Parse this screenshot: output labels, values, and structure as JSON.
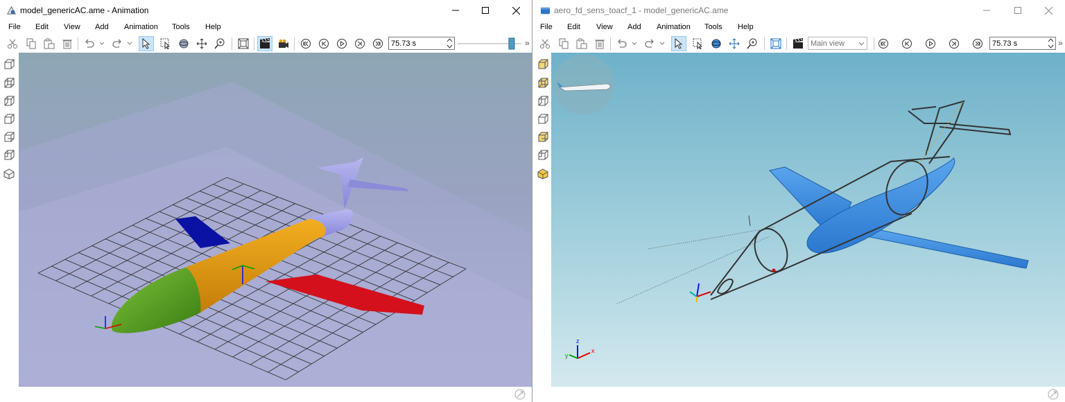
{
  "left_window": {
    "title": "model_genericAC.ame - Animation",
    "menu": [
      "File",
      "Edit",
      "View",
      "Add",
      "Animation",
      "Tools",
      "Help"
    ],
    "time_value": "75.73 s",
    "time_slider_fraction": 0.88,
    "overflow": "»",
    "toolbar_icons": [
      "scissors-icon",
      "copy-icon",
      "paste-icon",
      "delete-icon",
      "undo-icon",
      "redo-icon",
      "select-arrow-icon",
      "box-select-icon",
      "rotate-icon",
      "pan-icon",
      "zoom-icon",
      "fit-all-icon",
      "clapperboard-icon",
      "camera-icon",
      "skip-first-icon",
      "step-back-icon",
      "play-icon",
      "step-forward-icon",
      "skip-last-icon"
    ],
    "side_icons": [
      "front-view-icon",
      "back-view-icon",
      "left-view-icon",
      "right-view-icon",
      "top-view-icon",
      "bottom-view-icon",
      "iso-view-icon"
    ],
    "colors": {
      "nose": "#54a31e",
      "fuselage": "#e39a0d",
      "tail": "#9d9de6",
      "left_wing": "#0a12a3",
      "right_wing": "#d4101c",
      "sky_top": "#8ea6b4",
      "sky_bottom": "#adb0d8"
    }
  },
  "right_window": {
    "title": "aero_fd_sens_toacf_1 - model_genericAC.ame",
    "menu": [
      "File",
      "Edit",
      "View",
      "Add",
      "Animation",
      "Tools",
      "Help"
    ],
    "view_select": "Main view",
    "time_value": "75.73 s",
    "overflow": "»",
    "axis_labels": {
      "x": "x",
      "y": "y",
      "z": "z"
    },
    "toolbar_icons": [
      "scissors-icon",
      "copy-icon",
      "paste-icon",
      "delete-icon",
      "undo-icon",
      "redo-icon",
      "select-arrow-icon",
      "box-select-icon",
      "rotate-icon",
      "pan-icon",
      "zoom-icon",
      "fit-all-icon",
      "clapperboard-icon",
      "skip-first-icon",
      "step-back-icon",
      "play-icon",
      "step-forward-icon",
      "skip-last-icon"
    ],
    "side_icons": [
      "front-view-icon",
      "back-view-icon",
      "left-view-icon",
      "right-view-icon",
      "top-view-icon",
      "bottom-view-icon",
      "iso-view-icon"
    ],
    "colors": {
      "aircraft": "#3d8ee0",
      "sky_top": "#6eb1c9",
      "sky_bottom": "#d4e9ef"
    }
  }
}
